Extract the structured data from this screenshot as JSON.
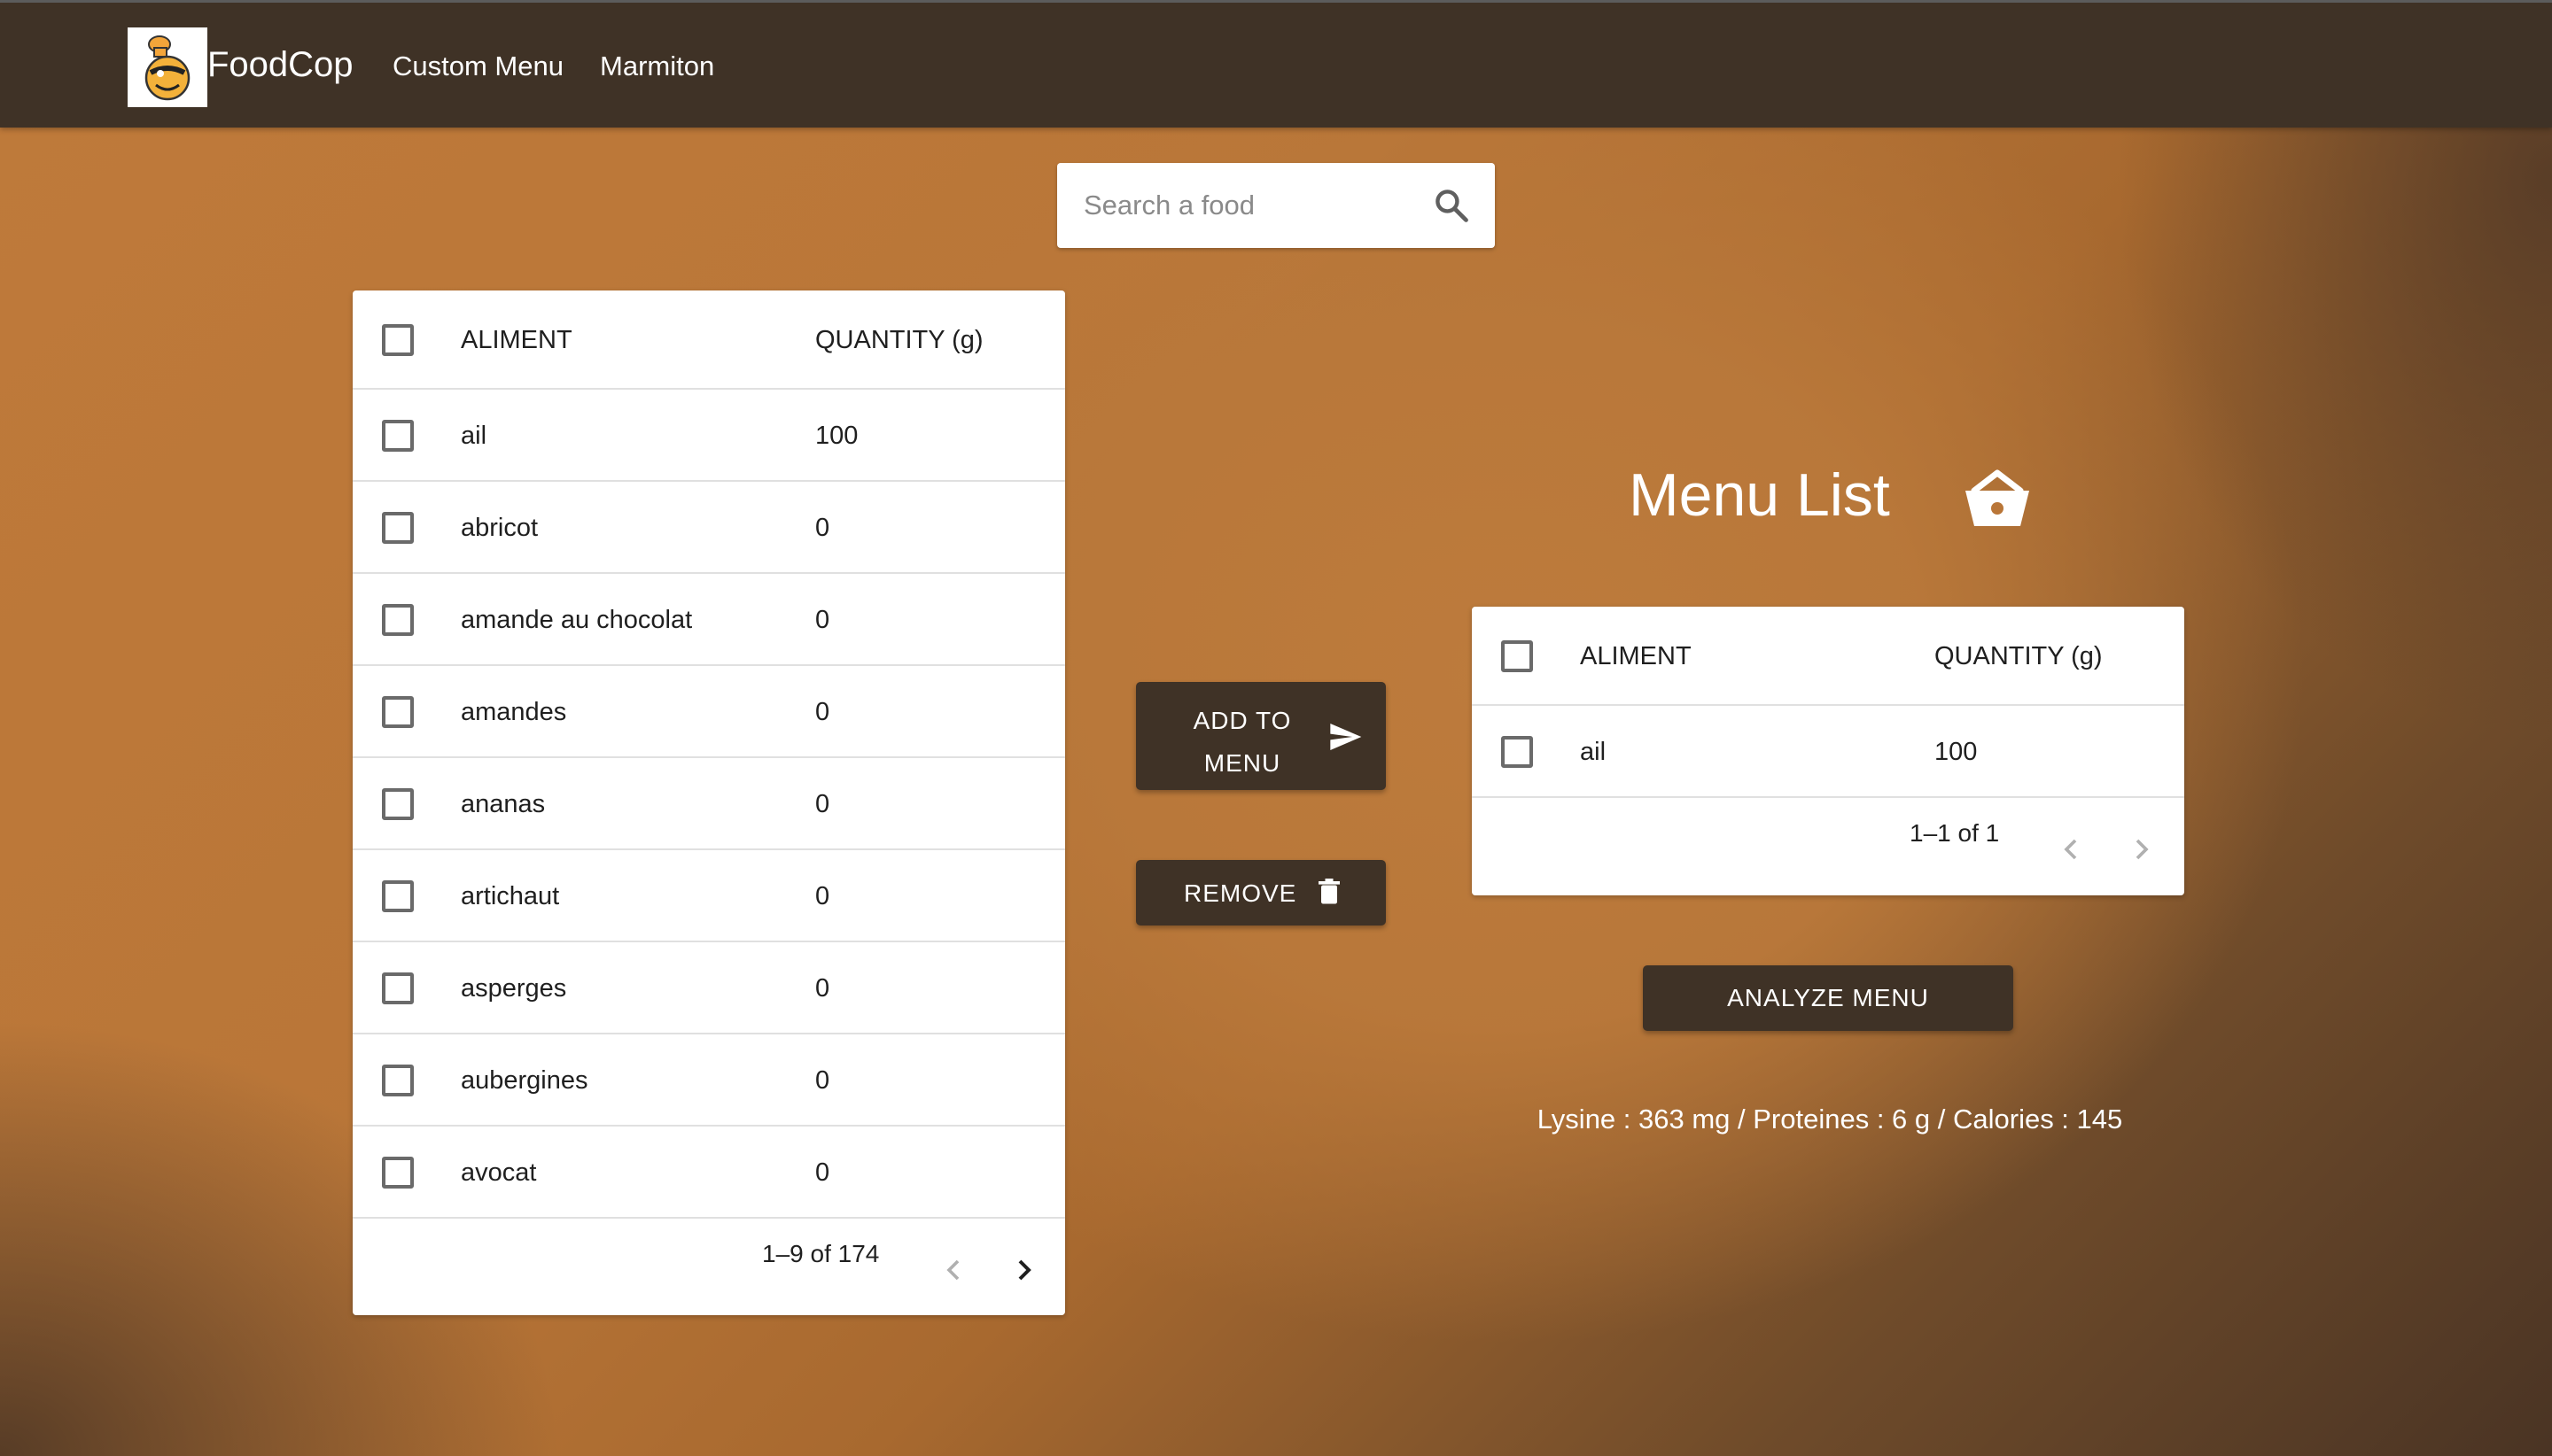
{
  "app": {
    "brand": "FoodCop",
    "nav": [
      "Custom Menu",
      "Marmiton"
    ]
  },
  "search": {
    "placeholder": "Search a food",
    "value": ""
  },
  "food_table": {
    "headers": [
      "ALIMENT",
      "QUANTITY (g)"
    ],
    "rows": [
      {
        "aliment": "ail",
        "quantity": "100"
      },
      {
        "aliment": "abricot",
        "quantity": "0"
      },
      {
        "aliment": "amande au chocolat",
        "quantity": "0"
      },
      {
        "aliment": "amandes",
        "quantity": "0"
      },
      {
        "aliment": "ananas",
        "quantity": "0"
      },
      {
        "aliment": "artichaut",
        "quantity": "0"
      },
      {
        "aliment": "asperges",
        "quantity": "0"
      },
      {
        "aliment": "aubergines",
        "quantity": "0"
      },
      {
        "aliment": "avocat",
        "quantity": "0"
      }
    ],
    "pagination": "1–9 of 174"
  },
  "actions": {
    "add_label": "ADD TO MENU",
    "remove_label": "REMOVE"
  },
  "menu": {
    "title": "Menu List",
    "headers": [
      "ALIMENT",
      "QUANTITY (g)"
    ],
    "rows": [
      {
        "aliment": "ail",
        "quantity": "100"
      }
    ],
    "pagination": "1–1 of 1",
    "analyze_label": "ANALYZE MENU",
    "result": "Lysine : 363 mg / Proteines : 6 g / Calories : 145"
  },
  "icons": {
    "search": "search-icon",
    "add": "send-icon",
    "remove": "trash-icon",
    "basket": "basket-icon",
    "prev": "chevron-left-icon",
    "next": "chevron-right-icon"
  },
  "colors": {
    "topbar": "#3f3226",
    "button": "#3f3226",
    "background_accent": "#b97638",
    "disabled_chevron": "#b0b0b0"
  }
}
